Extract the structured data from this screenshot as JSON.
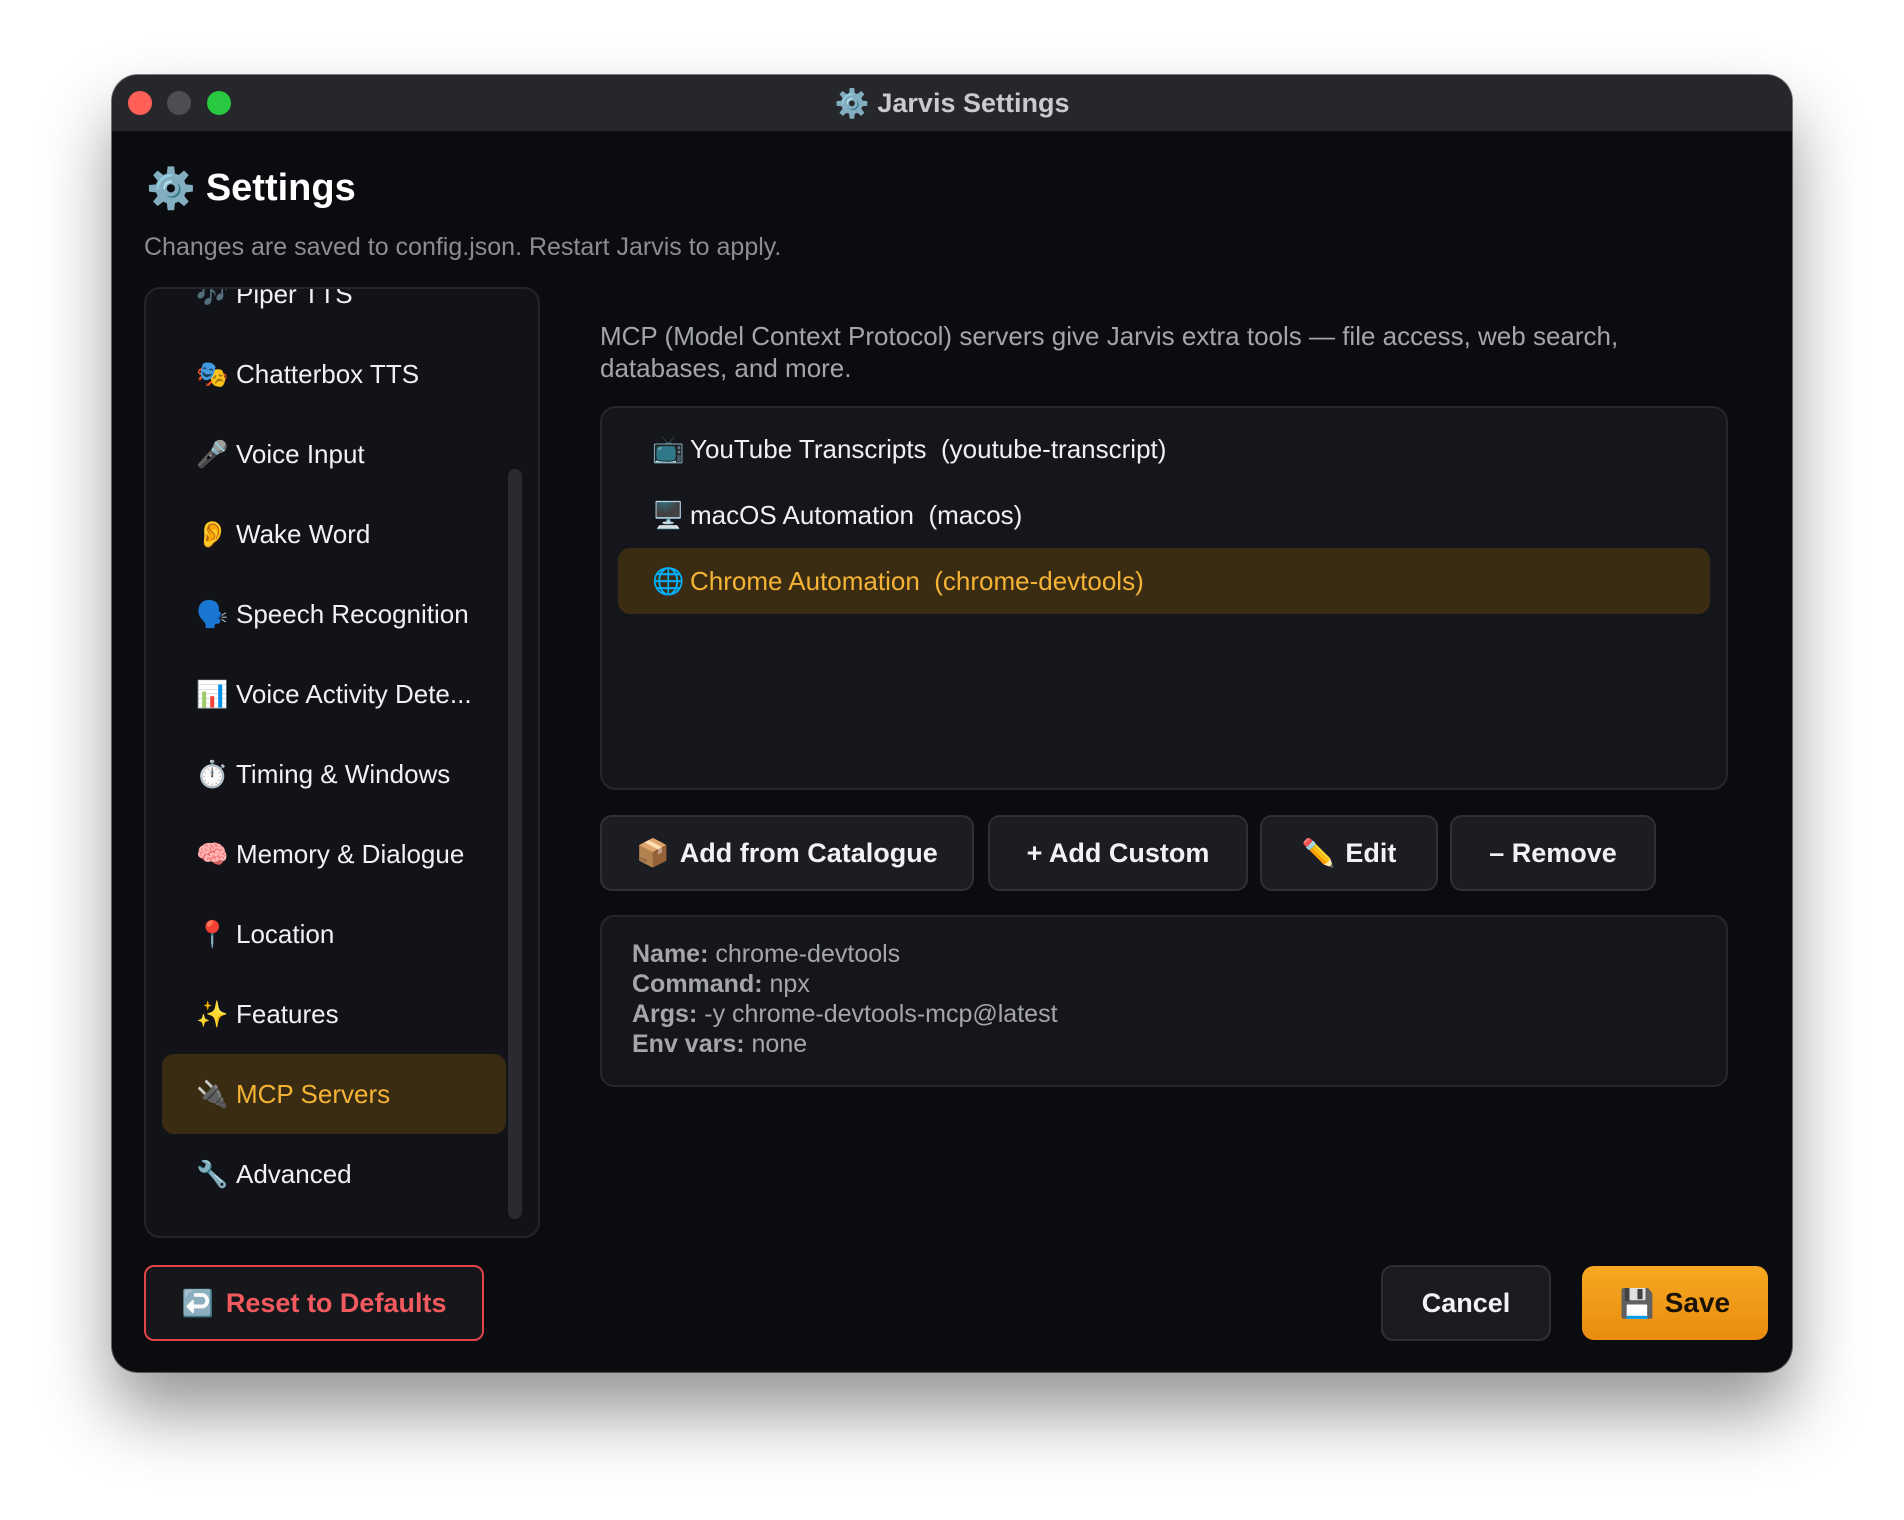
{
  "window": {
    "title": "Jarvis Settings",
    "title_icon": "⚙️"
  },
  "header": {
    "icon": "⚙️",
    "title": "Settings",
    "subtitle": "Changes are saved to config.json. Restart Jarvis to apply."
  },
  "sidebar": {
    "items": [
      {
        "icon": "🎶",
        "label": "Piper TTS"
      },
      {
        "icon": "🎭",
        "label": "Chatterbox TTS"
      },
      {
        "icon": "🎤",
        "label": "Voice Input"
      },
      {
        "icon": "👂",
        "label": "Wake Word"
      },
      {
        "icon": "🗣️",
        "label": "Speech Recognition"
      },
      {
        "icon": "📊",
        "label": "Voice Activity Dete..."
      },
      {
        "icon": "⏱️",
        "label": "Timing & Windows"
      },
      {
        "icon": "🧠",
        "label": "Memory & Dialogue"
      },
      {
        "icon": "📍",
        "label": "Location"
      },
      {
        "icon": "✨",
        "label": "Features"
      },
      {
        "icon": "🔌",
        "label": "MCP Servers"
      },
      {
        "icon": "🔧",
        "label": "Advanced"
      }
    ],
    "active_index": 10
  },
  "main": {
    "description": "MCP (Model Context Protocol) servers give Jarvis extra tools — file access, web search, databases, and more.",
    "servers": [
      {
        "icon": "📺",
        "label": "YouTube Transcripts  (youtube-transcript)"
      },
      {
        "icon": "🖥️",
        "label": "macOS Automation  (macos)"
      },
      {
        "icon": "🌐",
        "label": "Chrome Automation  (chrome-devtools)"
      }
    ],
    "selected_index": 2,
    "buttons": {
      "add_catalogue": {
        "icon": "📦",
        "label": "Add from Catalogue"
      },
      "add_custom": "+ Add Custom",
      "edit": {
        "icon": "✏️",
        "label": "Edit"
      },
      "remove": "– Remove"
    },
    "details": {
      "name_label": "Name:",
      "name_value": "chrome-devtools",
      "command_label": "Command:",
      "command_value": "npx",
      "args_label": "Args:",
      "args_value": "-y chrome-devtools-mcp@latest",
      "env_label": "Env vars:",
      "env_value": "none"
    }
  },
  "footer": {
    "reset": {
      "icon": "↩️",
      "label": "Reset to Defaults"
    },
    "cancel": "Cancel",
    "save": {
      "icon": "💾",
      "label": "Save"
    }
  },
  "colors": {
    "accent": "#f5a623",
    "selected_bg": "#3a2c12",
    "danger": "#e0454a",
    "window_bg": "#0b0c10"
  }
}
